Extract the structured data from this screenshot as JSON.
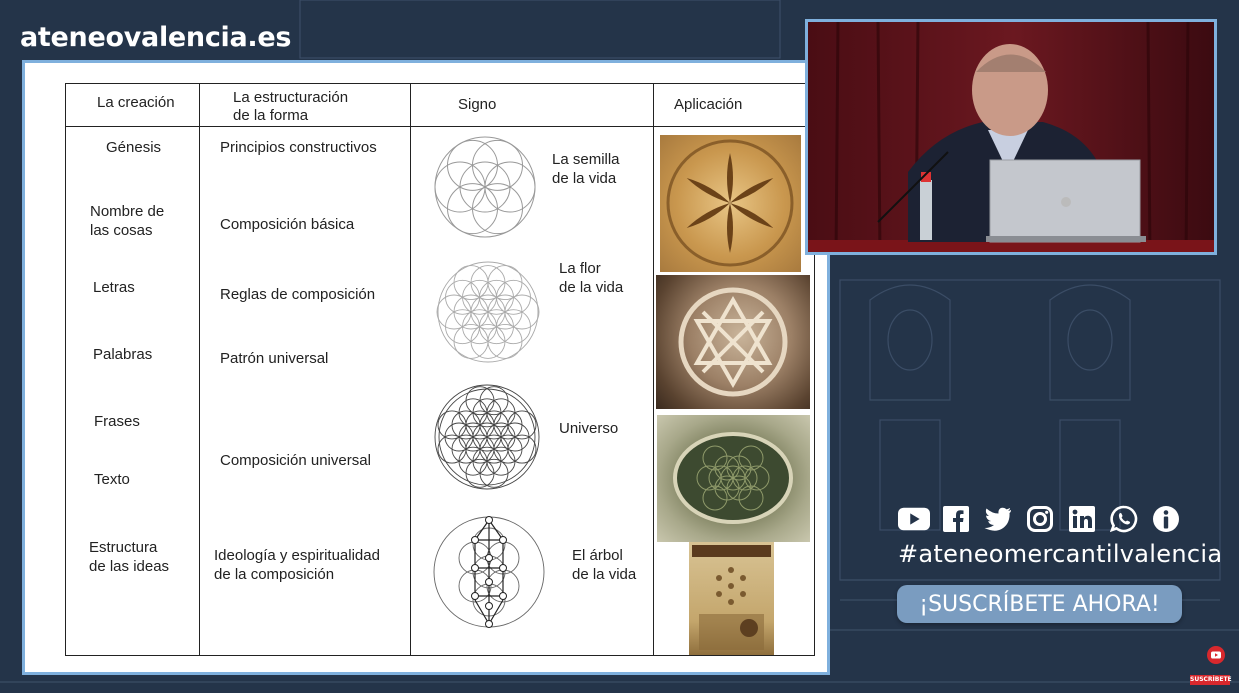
{
  "site": {
    "title": "ateneovalencia.es"
  },
  "slide": {
    "headers": {
      "creacion": "La creación",
      "estructuracion_1": "La estructuración",
      "estructuracion_2": "de la forma",
      "signo": "Signo",
      "aplicacion": "Aplicación"
    },
    "creacion": [
      "Génesis",
      "Nombre de\nlas cosas",
      "Letras",
      "Palabras",
      "Frases",
      "Texto",
      "Estructura\nde las ideas"
    ],
    "estructuracion": [
      "Principios constructivos",
      "Composición básica",
      "Reglas de composición",
      "Patrón universal",
      "Composición universal",
      "Ideología y espiritualidad\nde la composición"
    ],
    "signos": [
      "La semilla\nde la vida",
      "La flor\nde la vida",
      "Universo",
      "El árbol\nde la vida"
    ],
    "aplicacion_images": [
      "carved-hexafoil-stone",
      "carved-star-rosette",
      "gothic-rose-window",
      "tree-of-life-book-page"
    ]
  },
  "social": {
    "icons": [
      "youtube-icon",
      "facebook-icon",
      "twitter-icon",
      "instagram-icon",
      "linkedin-icon",
      "whatsapp-icon",
      "info-icon"
    ],
    "hashtag": "#ateneomercantilvalencia",
    "subscribe_label": "¡SUSCRÍBETE AHORA!"
  },
  "badge": {
    "label": "SUSCRÍBETE"
  },
  "colors": {
    "background": "#243449",
    "frame": "#7fb0dd",
    "subscribe": "#7a9cc0"
  }
}
